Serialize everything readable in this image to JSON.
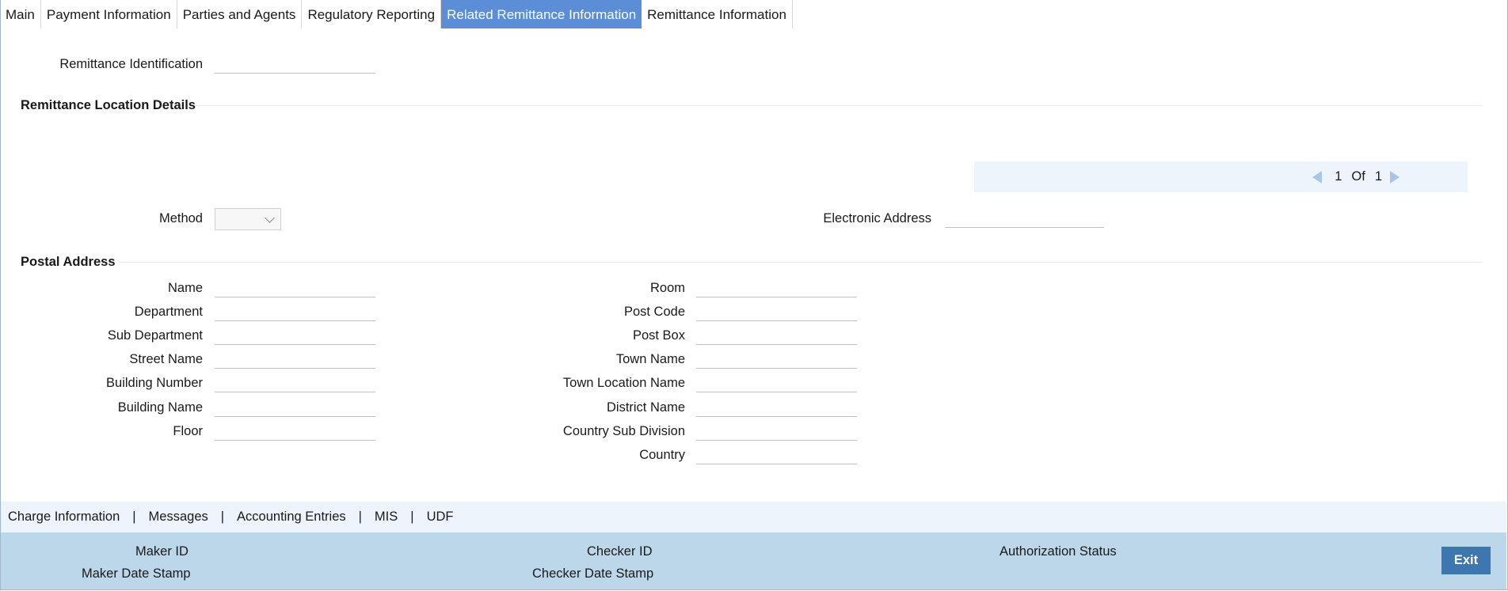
{
  "tabs": [
    "Main",
    "Payment Information",
    "Parties and Agents",
    "Regulatory Reporting",
    "Related Remittance Information",
    "Remittance Information"
  ],
  "active_tab_index": 4,
  "remittance_identification": {
    "label": "Remittance Identification",
    "value": ""
  },
  "location_section": {
    "title": "Remittance Location Details"
  },
  "pager": {
    "current": "1",
    "of_label": "Of",
    "total": "1"
  },
  "method": {
    "label": "Method",
    "value": ""
  },
  "electronic_address": {
    "label": "Electronic Address",
    "value": ""
  },
  "postal_section": {
    "title": "Postal Address"
  },
  "postal_left": [
    "Name",
    "Department",
    "Sub Department",
    "Street Name",
    "Building Number",
    "Building Name",
    "Floor"
  ],
  "postal_right": [
    "Room",
    "Post Code",
    "Post Box",
    "Town Name",
    "Town Location Name",
    "District Name",
    "Country Sub Division",
    "Country"
  ],
  "footer_links": [
    "Charge Information",
    "Messages",
    "Accounting Entries",
    "MIS",
    "UDF"
  ],
  "footer_separator": "|",
  "audit": {
    "maker_id": "Maker ID",
    "maker_date": "Maker Date Stamp",
    "checker_id": "Checker ID",
    "checker_date": "Checker Date Stamp",
    "auth_status": "Authorization Status"
  },
  "exit_label": "Exit",
  "colors": {
    "active_tab": "#5b8ed6",
    "audit_bar": "#bcd6ea",
    "exit_button": "#3e77b0",
    "link_bar": "#eef4fb"
  }
}
